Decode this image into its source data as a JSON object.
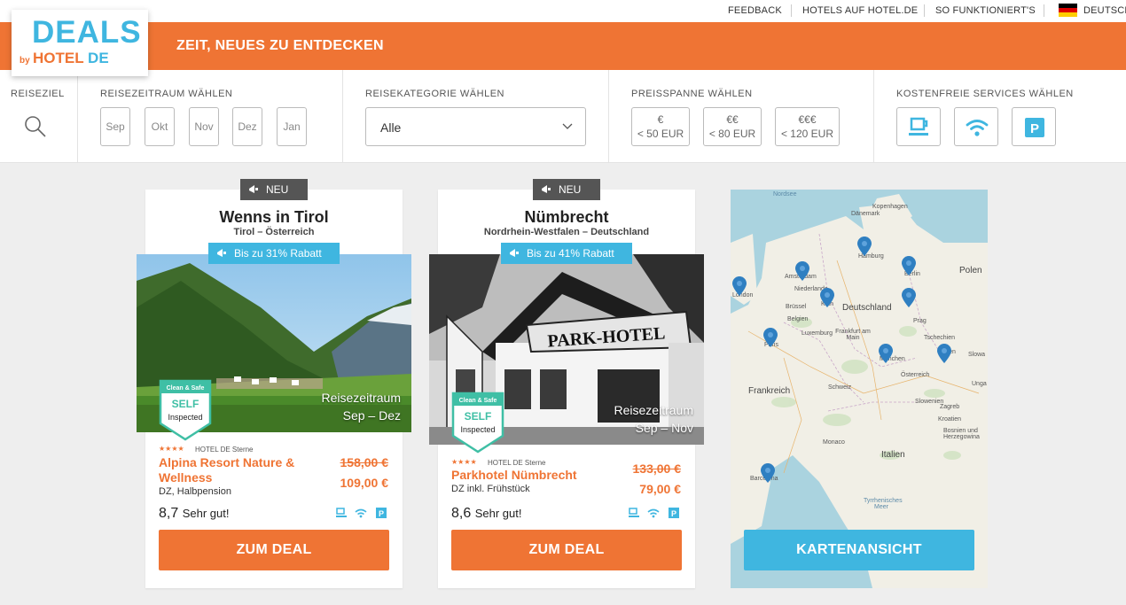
{
  "header": {
    "links": [
      {
        "label": "FEEDBACK"
      },
      {
        "label": "HOTELS AUF HOTEL.DE"
      },
      {
        "label": "SO FUNKTIONIERT'S"
      },
      {
        "label": "DEUTSCH"
      }
    ],
    "flag_colors": [
      "#000000",
      "#dd0000",
      "#ffce00"
    ]
  },
  "logo": {
    "deals": "DEALS",
    "by": "by",
    "hotel": "HOTEL",
    "de": "DE"
  },
  "banner": {
    "tagline": "ZEIT, NEUES ZU ENTDECKEN",
    "color": "#ef7434"
  },
  "filters": {
    "destination_label": "REISEZIEL",
    "period_label": "REISEZEITRAUM WÄHLEN",
    "months": [
      "Sep",
      "Okt",
      "Nov",
      "Dez",
      "Jan"
    ],
    "category_label": "REISEKATEGORIE WÄHLEN",
    "category_value": "Alle",
    "price_label": "PREISSPANNE WÄHLEN",
    "prices": [
      {
        "symbol": "€",
        "label": "< 50 EUR"
      },
      {
        "symbol": "€€",
        "label": "< 80 EUR"
      },
      {
        "symbol": "€€€",
        "label": "< 120 EUR"
      }
    ],
    "services_label": "KOSTENFREIE SERVICES WÄHLEN",
    "services": [
      "breakfast-icon",
      "wifi-icon",
      "parking-icon"
    ]
  },
  "cards": [
    {
      "new_label": "NEU",
      "city": "Wenns in Tirol",
      "region": "Tirol – Österreich",
      "discount": "Bis zu 31% Rabatt",
      "period_label": "Reisezeitraum",
      "period": "Sep – Dez",
      "badge_top": "Clean & Safe",
      "badge_mid": "SELF",
      "badge_bottom": "Inspected",
      "stars": "★★★★",
      "stars_label": "HOTEL DE Sterne",
      "hotel_name_1": "Alpina Resort Nature &",
      "hotel_name_2": "Wellness",
      "meal": "DZ, Halbpension",
      "old_price": "158,00 €",
      "new_price": "109,00 €",
      "score": "8,7",
      "score_text": "Sehr gut!",
      "button": "ZUM DEAL"
    },
    {
      "new_label": "NEU",
      "city": "Nümbrecht",
      "region": "Nordrhein-Westfalen – Deutschland",
      "discount": "Bis zu 41% Rabatt",
      "period_label": "Reisezeitraum",
      "period": "Sep – Nov",
      "badge_top": "Clean & Safe",
      "badge_mid": "SELF",
      "badge_bottom": "Inspected",
      "stars": "★★★★",
      "stars_label": "HOTEL DE Sterne",
      "hotel_name_1": "Parkhotel Nümbrecht",
      "meal": "DZ inkl. Frühstück",
      "old_price": "133,00 €",
      "new_price": "79,00 €",
      "score": "8,6",
      "score_text": "Sehr gut!",
      "button": "ZUM DEAL",
      "sign_text": "PARK-HOTEL"
    }
  ],
  "map": {
    "labels": {
      "nordsee": "Nordsee",
      "kopenhagen": "Kopenhagen",
      "danemark": "Dänemark",
      "hamburg": "Hamburg",
      "amsterdam": "Amsterdam",
      "niederlande": "Niederlande",
      "berlin": "Berlin",
      "polen": "Polen",
      "london": "London",
      "brussel": "Brüssel",
      "belgien": "Belgien",
      "koln": "Köln",
      "deutschland": "Deutschland",
      "luxemburg": "Luxemburg",
      "frankfurt": "Frankfurt am Main",
      "prag": "Prag",
      "tschechien": "Tschechien",
      "paris": "Paris",
      "munchen": "München",
      "wien": "Wien",
      "slowakei": "Slowa",
      "ungarn": "Unga",
      "frankreich": "Frankreich",
      "schweiz": "Schweiz",
      "osterreich": "Österreich",
      "slowenien": "Slowenien",
      "zagreb": "Zagreb",
      "kroatien": "Kroatien",
      "monaco": "Monaco",
      "bosnien": "Bosnien und Herzegowina",
      "italien": "Italien",
      "barcelona": "Barcelona",
      "tyrrhenisches": "Tyrrhenisches Meer",
      "bosnien2": "Herzegowina"
    },
    "button": "KARTENANSICHT"
  }
}
